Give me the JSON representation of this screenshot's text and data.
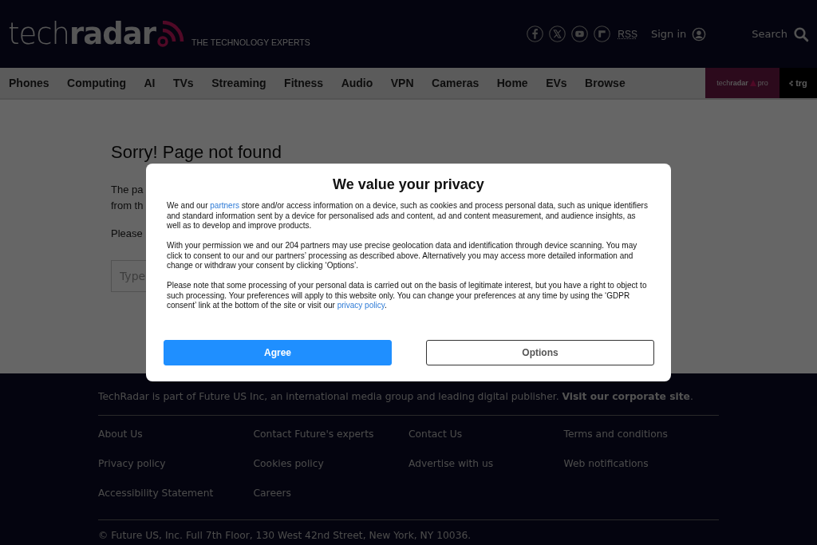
{
  "header": {
    "logo": "tech**radar**",
    "tagline": "THE TECHNOLOGY EXPERTS",
    "rss": "RSS",
    "sign_in": "Sign in",
    "search": "Search"
  },
  "nav": {
    "items": [
      "Phones",
      "Computing",
      "AI",
      "TVs",
      "Streaming",
      "Fitness",
      "Audio",
      "VPN",
      "Cameras",
      "Home",
      "EVs",
      "Browse"
    ],
    "pro_brand": "tech**radar**",
    "pro_label": "pro",
    "trg": "trg"
  },
  "error": {
    "title": "Sorry! Page not found",
    "lines": [
      "The pa",
      "from th"
    ],
    "hint": "Please",
    "search_placeholder": "Type"
  },
  "footer": {
    "notice": "TechRadar is part of Future US Inc, an international media group and leading digital publisher.",
    "notice_link": "Visit our corporate site",
    "notice_end": ".",
    "links": [
      "About Us",
      "Contact Future's experts",
      "Contact Us",
      "Terms and conditions",
      "Privacy policy",
      "Cookies policy",
      "Advertise with us",
      "Web notifications",
      "Accessibility Statement",
      "Careers"
    ],
    "copyright": "© Future US, Inc. Full 7th Floor, 130 West 42nd Street, New York, NY 10036."
  },
  "consent": {
    "title": "We value your privacy",
    "paragraphs": [
      [
        {
          "text": "We and our "
        },
        {
          "text": "partners",
          "link": true
        },
        {
          "text": " store and/or access information on a device, such as cookies and process personal data, such as unique identifiers and standard information sent by a device for personalised ads and content, ad and content measurement, and audience insights, as well as to develop and improve products."
        }
      ],
      [
        {
          "text": "With your permission we and our 204 partners may use precise geolocation data and identification through device scanning. You may click to consent to our and our partners’ processing as described above. Alternatively you may access more detailed information and change or withdraw your consent by clicking ‘Options’."
        }
      ],
      [
        {
          "text": "Please note that some processing of your personal data is carried out on the basis of legitimate interest, but you have a right to object to such processing. Your preferences will apply to this website only. You can change your preferences at any time by using the ‘GDPR consent’ link at the bottom of the site or visit our "
        },
        {
          "text": "privacy policy",
          "link": true
        },
        {
          "text": "."
        }
      ]
    ],
    "buttons": [
      {
        "label": "Agree",
        "kind": "primary"
      },
      {
        "label": "Options",
        "kind": "secondary"
      }
    ]
  }
}
